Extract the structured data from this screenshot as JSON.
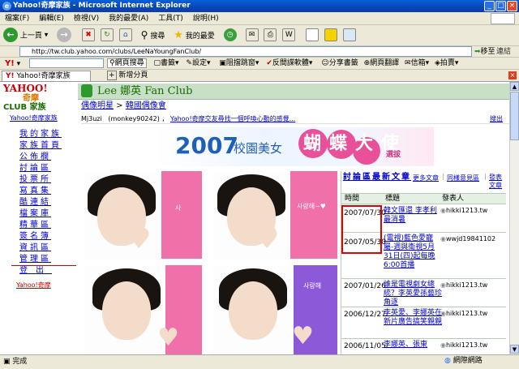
{
  "window": {
    "title": "Yahoo!奇摩家族 - Microsoft Internet Explorer",
    "controls": [
      "_",
      "□",
      "×"
    ]
  },
  "menu": [
    "檔案(F)",
    "編輯(E)",
    "檢視(V)",
    "我的最愛(A)",
    "工具(T)",
    "說明(H)"
  ],
  "toolbar": {
    "back": "上一頁",
    "search": "搜尋",
    "favorites": "我的最愛"
  },
  "address": {
    "url": "http://tw.club.yahoo.com/clubs/LeeNaYoungFanClub/",
    "go": "移至",
    "links": "連結"
  },
  "yahoo_toolbar": {
    "logo": "Y!",
    "search_btn": "網頁搜尋",
    "bookmarks": "書籤",
    "settings": "設定",
    "block_popup": "阻擋跳窗",
    "anti_phishing": "反間諜軟體",
    "share": "分享書籤",
    "translate": "網頁翻譯",
    "mail": "信箱",
    "auction": "拍賣"
  },
  "tabs": {
    "active": "Yahoo!奇摩家族",
    "new": "新增分頁"
  },
  "page": {
    "club_title": "Lee 娜英 Fan Club",
    "breadcrumb": [
      "偶像明星",
      "韓國偶像會"
    ],
    "logo_line1": "YAHOO!",
    "logo_line2": "奇摩",
    "logo_line3": "CLUB 家族",
    "logo_link": "Yahoo!奇摩家族",
    "ticker_user": "Mj3uzi",
    "ticker_id": "(monkey90242)",
    "ticker_link": "Yahoo!奇摩交友尋找一個呼喚心動的感覺...",
    "ticker_more": "搜出",
    "banner_year": "2007",
    "banner_text": "校園美女",
    "banner_title": "蝴蝶大使",
    "banner_sub": "選拔",
    "nav": [
      "我的家族",
      "家族首頁",
      "公佈欄",
      "討論區",
      "投票所",
      "寫真集",
      "酷連結",
      "檔案庫",
      "精華區",
      "簽名簿",
      "資訊區",
      "管理區",
      "登出"
    ],
    "nav_bottom": "Yahoo!奇摩",
    "photo_tags": [
      "사",
      "사랑해~♥",
      "사랑해"
    ]
  },
  "forum": {
    "title": "討論區最新文章",
    "more": "更多文章",
    "sync": "同樣意見區",
    "post": "發表文章",
    "headers": [
      "時間",
      "標題",
      "發表人"
    ],
    "rows": [
      {
        "date": "2007/07/30",
        "title": "韓文匯還 李孝利最消暑",
        "author": "hikki1213.tw"
      },
      {
        "date": "2007/05/30",
        "title": "(電視)藍色愛寵屬-週與衛視5月31日(四)起每晚6:00首播",
        "author": "wwjd19841102"
      },
      {
        "date": "2007/01/26",
        "title": "誰是電視劇女總統？李英愛孫藝珍角逐",
        "author": "hikki1213.tw"
      },
      {
        "date": "2006/12/27",
        "title": "李英愛、李娜英在新片廣告搞笑親親",
        "author": "hikki1213.tw"
      },
      {
        "date": "2006/11/05",
        "title": "李娜英、張東",
        "author": "hikki1213.tw"
      }
    ]
  },
  "status": {
    "left": "完成",
    "right": "網際網路"
  },
  "colors": {
    "title_blue": "#0846b8",
    "club_green": "#1b6b00",
    "link_blue": "#0000cc",
    "highlight_red": "#e00000",
    "banner_blue": "#1e5fb8",
    "pink": "#e8509a"
  }
}
